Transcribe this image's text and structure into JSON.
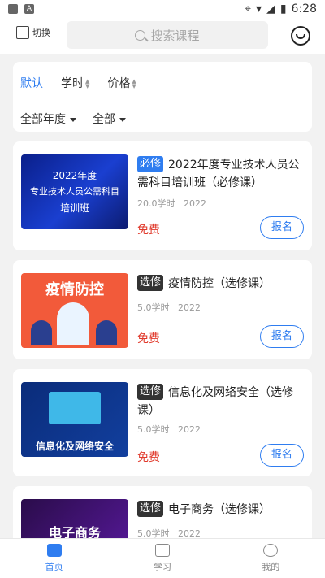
{
  "status": {
    "time": "6:28"
  },
  "header": {
    "switch_label": "切换",
    "search_placeholder": "搜索课程"
  },
  "sort": {
    "items": [
      "默认",
      "学时",
      "价格"
    ]
  },
  "filters": {
    "year": "全部年度",
    "type": "全部"
  },
  "courses": [
    {
      "tag": "必修",
      "tag_color": "#2f7df0",
      "title": "2022年度专业技术人员公需科目培训班（必修课）",
      "hours": "20.0学时",
      "year": "2022",
      "price": "免费",
      "action": "报名",
      "thumb_lines": [
        "2022年度",
        "专业技术人员公需科目",
        "培训班"
      ]
    },
    {
      "tag": "选修",
      "tag_color": "#333333",
      "title": "疫情防控（选修课）",
      "hours": "5.0学时",
      "year": "2022",
      "price": "免费",
      "action": "报名",
      "thumb_lines": [
        "疫情防控"
      ]
    },
    {
      "tag": "选修",
      "tag_color": "#333333",
      "title": "信息化及网络安全（选修课）",
      "hours": "5.0学时",
      "year": "2022",
      "price": "免费",
      "action": "报名",
      "thumb_lines": [
        "信息化及网络安全"
      ]
    },
    {
      "tag": "选修",
      "tag_color": "#333333",
      "title": "电子商务（选修课）",
      "hours": "5.0学时",
      "year": "2022",
      "price": "",
      "action": "",
      "thumb_lines": [
        "电子商务"
      ]
    }
  ],
  "tabbar": {
    "items": [
      "首页",
      "学习",
      "我的"
    ]
  }
}
